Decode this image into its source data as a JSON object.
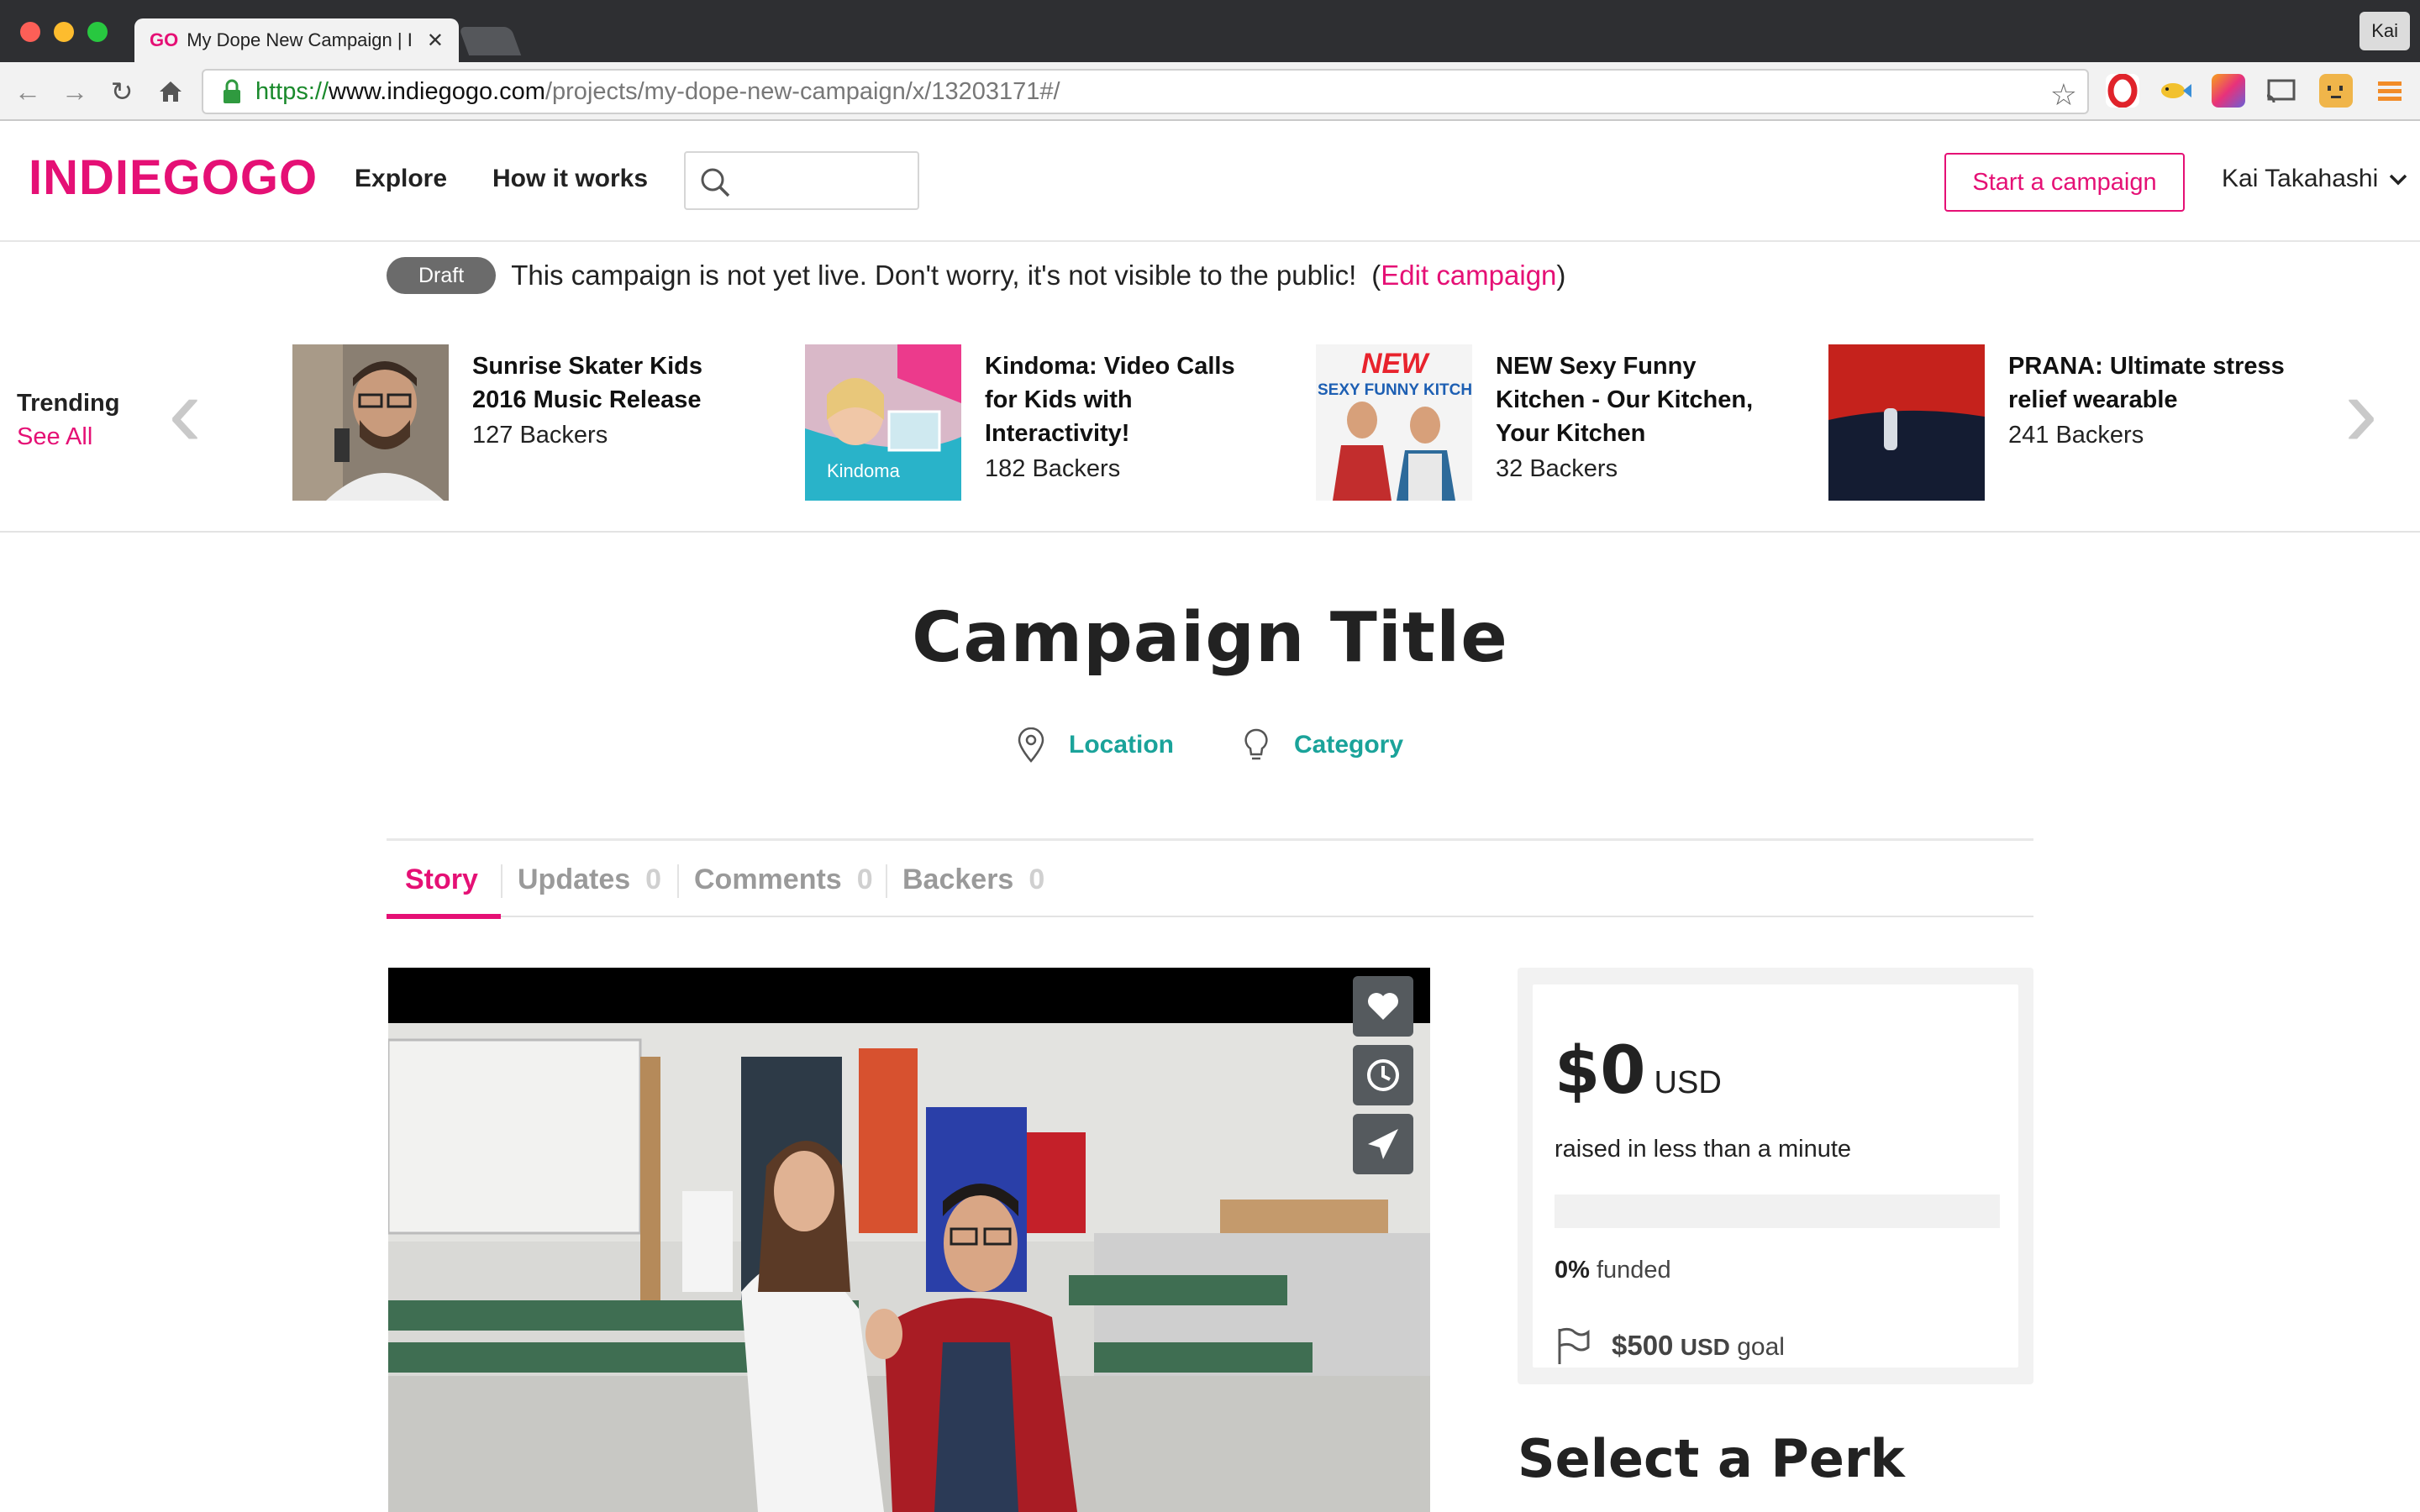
{
  "browser": {
    "tab_favicon": "GO",
    "tab_title": "My Dope New Campaign | I",
    "profile_name": "Kai",
    "url": {
      "scheme": "https://",
      "host": "www.indiegogo.com",
      "path": "/projects/my-dope-new-campaign/x/13203171#/"
    }
  },
  "header": {
    "logo": "INDIEGOGO",
    "nav": [
      "Explore",
      "How it works"
    ],
    "start_label": "Start a campaign",
    "user_name": "Kai Takahashi"
  },
  "draft": {
    "badge": "Draft",
    "message": "This campaign is not yet live. Don't worry, it's not visible to the public!",
    "open_paren": "(",
    "edit_link": "Edit campaign",
    "close_paren": ")"
  },
  "trending": {
    "label": "Trending",
    "see_all": "See All",
    "items": [
      {
        "title": "Sunrise Skater Kids 2016 Music Release",
        "backers": "127 Backers"
      },
      {
        "title": "Kindoma: Video Calls for Kids with Interactivity!",
        "backers": "182 Backers"
      },
      {
        "title": "NEW Sexy Funny Kitchen - Our Kitchen, Your Kitchen",
        "backers": "32 Backers"
      },
      {
        "title": "PRANA: Ultimate stress relief wearable",
        "backers": "241 Backers"
      }
    ],
    "thumb_text": {
      "kindoma_brand": "Kindoma",
      "new_badge": "NEW",
      "kitchen_banner": "SEXY FUNNY KITCHEN"
    }
  },
  "campaign": {
    "title": "Campaign Title",
    "location": "Location",
    "category": "Category",
    "tabs": [
      {
        "label": "Story",
        "count": ""
      },
      {
        "label": "Updates",
        "count": "0"
      },
      {
        "label": "Comments",
        "count": "0"
      },
      {
        "label": "Backers",
        "count": "0"
      }
    ]
  },
  "funding": {
    "amount": "$0",
    "currency": "USD",
    "raised_time": "raised in less than a minute",
    "percent_label": "0%",
    "funded_word": "funded",
    "progress_fraction": 0,
    "goal_amount": "$500",
    "goal_currency": "USD",
    "goal_word": "goal"
  },
  "perk_heading": "Select a Perk",
  "colors": {
    "brand": "#e51075",
    "teal": "#1aa39a"
  },
  "icons": [
    "lock-icon",
    "star-icon",
    "search-icon",
    "chevron-down-icon",
    "location-pin-icon",
    "lightbulb-icon",
    "heart-icon",
    "clock-icon",
    "send-icon",
    "flag-icon"
  ]
}
